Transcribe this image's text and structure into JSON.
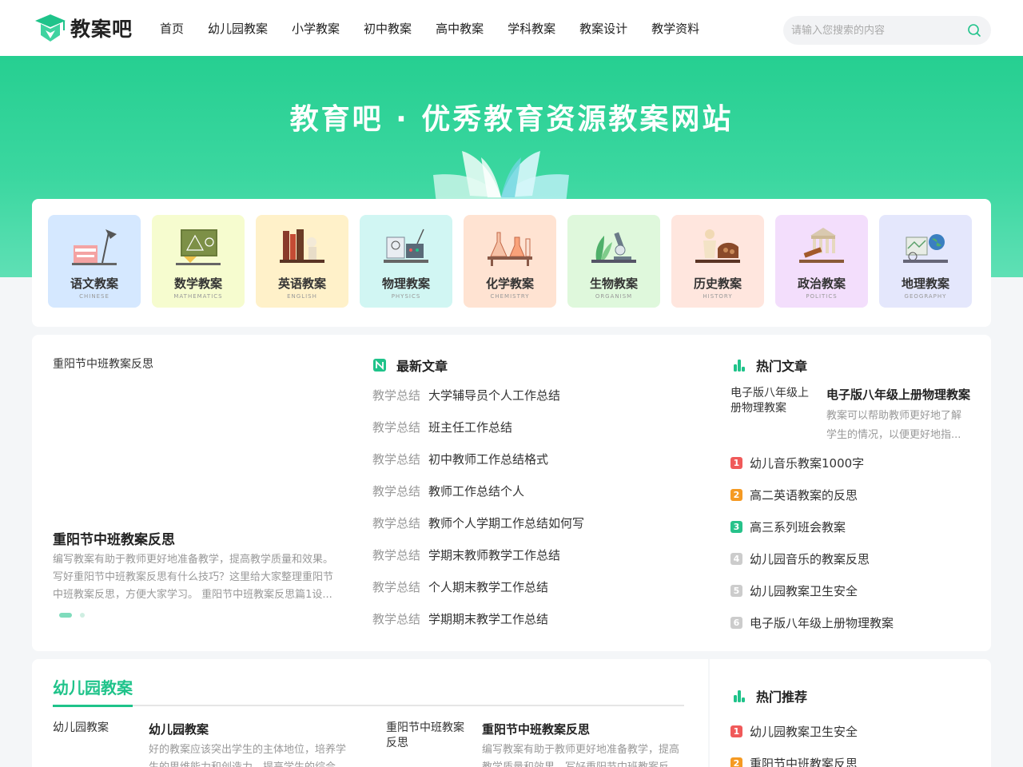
{
  "header": {
    "logo_text": "教案吧",
    "nav": [
      "首页",
      "幼儿园教案",
      "小学教案",
      "初中教案",
      "高中教案",
      "学科教案",
      "教案设计",
      "教学资料"
    ],
    "search_placeholder": "请输入您搜索的内容"
  },
  "banner": {
    "title": "教育吧 · 优秀教育资源教案网站"
  },
  "categories": [
    {
      "name": "语文教案",
      "en": "CHINESE",
      "bg": "#d5e8ff"
    },
    {
      "name": "数学教案",
      "en": "MATHEMATICS",
      "bg": "#f6fccf"
    },
    {
      "name": "英语教案",
      "en": "ENGLISH",
      "bg": "#fff1c9"
    },
    {
      "name": "物理教案",
      "en": "PHYSICS",
      "bg": "#d1f6f3"
    },
    {
      "name": "化学教案",
      "en": "CHEMISTRY",
      "bg": "#ffe3d2"
    },
    {
      "name": "生物教案",
      "en": "ORGANISM",
      "bg": "#dff8dc"
    },
    {
      "name": "历史教案",
      "en": "HISTORY",
      "bg": "#ffe6de"
    },
    {
      "name": "政治教案",
      "en": "POLITICS",
      "bg": "#f3defc"
    },
    {
      "name": "地理教案",
      "en": "GEOGRAPHY",
      "bg": "#e4e7fc"
    }
  ],
  "featured": {
    "img_alt": "重阳节中班教案反思",
    "title": "重阳节中班教案反思",
    "desc": "编写教案有助于教师更好地准备教学，提高教学质量和效果。写好重阳节中班教案反思有什么技巧？这里给大家整理重阳节中班教案反思，方便大家学习。 重阳节中班教案反思篇1设..."
  },
  "latest": {
    "title": "最新文章",
    "items": [
      {
        "cat": "教学总结",
        "title": "大学辅导员个人工作总结"
      },
      {
        "cat": "教学总结",
        "title": "班主任工作总结"
      },
      {
        "cat": "教学总结",
        "title": "初中教师工作总结格式"
      },
      {
        "cat": "教学总结",
        "title": "教师工作总结个人"
      },
      {
        "cat": "教学总结",
        "title": "教师个人学期工作总结如何写"
      },
      {
        "cat": "教学总结",
        "title": "学期末教师教学工作总结"
      },
      {
        "cat": "教学总结",
        "title": "个人期末教学工作总结"
      },
      {
        "cat": "教学总结",
        "title": "学期期末教学工作总结"
      }
    ]
  },
  "hot": {
    "title": "热门文章",
    "top": {
      "img_alt": "电子版八年级上册物理教案",
      "title": "电子版八年级上册物理教案",
      "desc": "教案可以帮助教师更好地了解学生的情况，以便更好地指..."
    },
    "items": [
      {
        "num": "1",
        "title": "幼儿音乐教案1000字",
        "color": "#f05a5a"
      },
      {
        "num": "2",
        "title": "高二英语教案的反思",
        "color": "#f59a23"
      },
      {
        "num": "3",
        "title": "高三系列班会教案",
        "color": "#27c28a"
      },
      {
        "num": "4",
        "title": "幼儿园音乐的教案反思",
        "color": "#cccccc"
      },
      {
        "num": "5",
        "title": "幼儿园教案卫生安全",
        "color": "#cccccc"
      },
      {
        "num": "6",
        "title": "电子版八年级上册物理教案",
        "color": "#cccccc"
      }
    ]
  },
  "kindergarten": {
    "title": "幼儿园教案",
    "cards": [
      {
        "img_alt": "幼儿园教案",
        "title": "幼儿园教案",
        "desc": "好的教案应该突出学生的主体地位，培养学生的思维能力和创造力，提高学生的综合..."
      },
      {
        "img_alt": "重阳节中班教案反思",
        "title": "重阳节中班教案反思",
        "desc": "编写教案有助于教师更好地准备教学，提高教学质量和效果。写好重阳节中班教案反..."
      }
    ]
  },
  "recommend": {
    "title": "热门推荐",
    "items": [
      {
        "num": "1",
        "title": "幼儿园教案卫生安全",
        "color": "#f05a5a"
      },
      {
        "num": "2",
        "title": "重阳节中班教案反思",
        "color": "#f59a23"
      }
    ]
  },
  "colors": {
    "brand": "#1fc38a",
    "banner_top": "#26cf91"
  }
}
